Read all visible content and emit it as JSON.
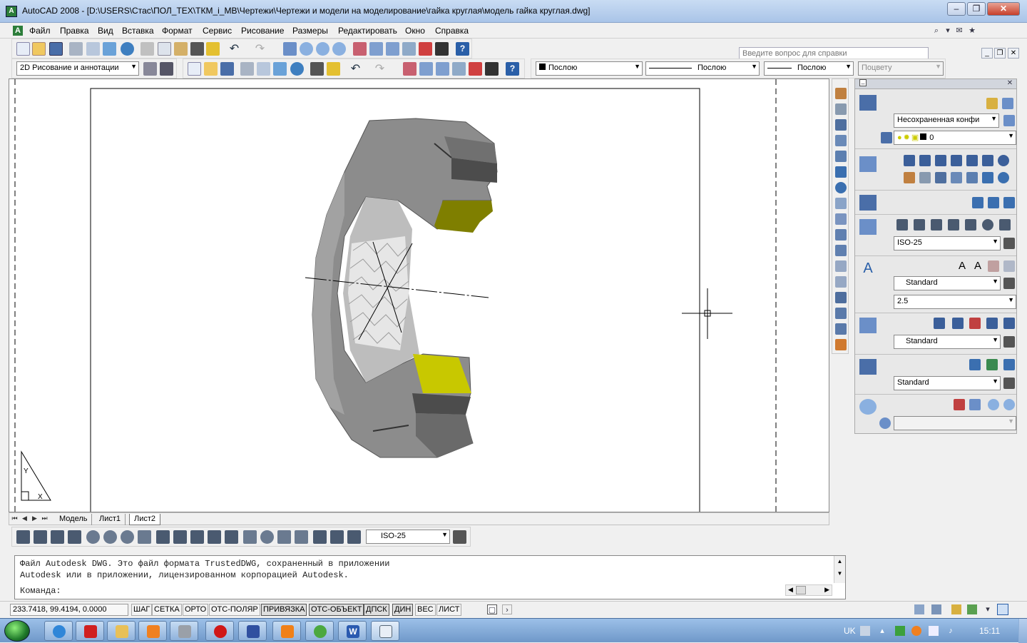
{
  "window": {
    "title": "AutoCAD 2008 - [D:\\USERS\\Стас\\ПОЛ_ТЕХ\\ТКМ_i_МВ\\Чертежи\\Чертежи и модели на моделирование\\гайка круглая\\модель гайка круглая.dwg]",
    "minimize": "‒",
    "restore": "❐",
    "close": "✕"
  },
  "menu": {
    "items": [
      "Файл",
      "Правка",
      "Вид",
      "Вставка",
      "Формат",
      "Сервис",
      "Рисование",
      "Размеры",
      "Редактировать",
      "Окно",
      "Справка"
    ],
    "help_placeholder": "Введите вопрос для справки"
  },
  "toolbar2": {
    "workspace": "2D Рисование и аннотации",
    "color": "Послою",
    "linetype": "Послою",
    "lineweight": "Послою",
    "plotstyle": "Поцвету"
  },
  "palette": {
    "layer_state": "Несохраненная конфи",
    "layer_name": "0",
    "dim_style": "ISO-25",
    "text_style": "Standard",
    "text_height": "2.5",
    "mleader_style": "Standard",
    "table_style": "Standard",
    "render_preset": ""
  },
  "tabs": {
    "items": [
      "Модель",
      "Лист1",
      "Лист2"
    ],
    "active": "Лист2"
  },
  "dimbar": {
    "dim_style": "ISO-25"
  },
  "command": {
    "line1": "Файл Autodesk DWG. Это файл формата TrustedDWG, сохраненный в приложении",
    "line2": "Autodesk или в приложении, лицензированном корпорацией Autodesk.",
    "prompt": "Команда:"
  },
  "status": {
    "coords": "233.7418, 99.4194, 0.0000",
    "buttons": [
      {
        "label": "ШАГ",
        "on": false
      },
      {
        "label": "СЕТКА",
        "on": false
      },
      {
        "label": "ОРТО",
        "on": false
      },
      {
        "label": "ОТС-ПОЛЯР",
        "on": false
      },
      {
        "label": "ПРИВЯЗКА",
        "on": true
      },
      {
        "label": "ОТС-ОБЪЕКТ",
        "on": true
      },
      {
        "label": "ДПСК",
        "on": true
      },
      {
        "label": "ДИН",
        "on": true
      },
      {
        "label": "ВЕС",
        "on": false
      },
      {
        "label": "ЛИСТ",
        "on": false
      }
    ]
  },
  "taskbar": {
    "language": "UK",
    "time": "15:11"
  },
  "colors": {
    "nut_gray": "#8c8c8c",
    "thread_yellow": "#7f7f00",
    "thread_yellow_lower": "#c8c800",
    "accent_blue": "#2a5fa8"
  }
}
